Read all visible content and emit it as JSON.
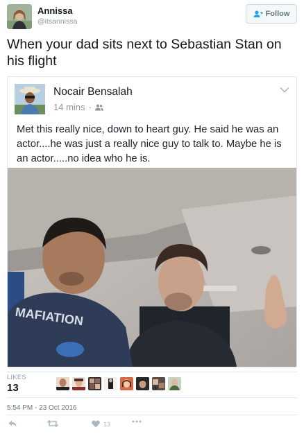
{
  "author": {
    "name": "Annissa",
    "handle": "@itsannissa",
    "follow_label": "Follow"
  },
  "tweet_text": "When your dad sits next to Sebastian Stan on his flight",
  "quoted_post": {
    "author_name": "Nocair Bensalah",
    "time": "14 mins",
    "text": "Met this really nice, down to heart guy.  He said he was an actor....he was just a really nice guy to talk to.  Maybe he is an actor.....no idea who he is.",
    "shirt_text": "MAFIATION"
  },
  "stats": {
    "likes_label": "LIKES",
    "likes_count": "13"
  },
  "timestamp": "5:54 PM - 23 Oct 2016",
  "actions": {
    "like_count": "13"
  },
  "icons": [
    "follow-person-icon",
    "chevron-down-icon",
    "friends-icon",
    "reply-icon",
    "retweet-icon",
    "heart-icon",
    "more-icon"
  ],
  "colors": {
    "text": "#14171a",
    "secondary": "#8899a6",
    "border": "#e1e8ed",
    "action": "#aab8c2"
  }
}
